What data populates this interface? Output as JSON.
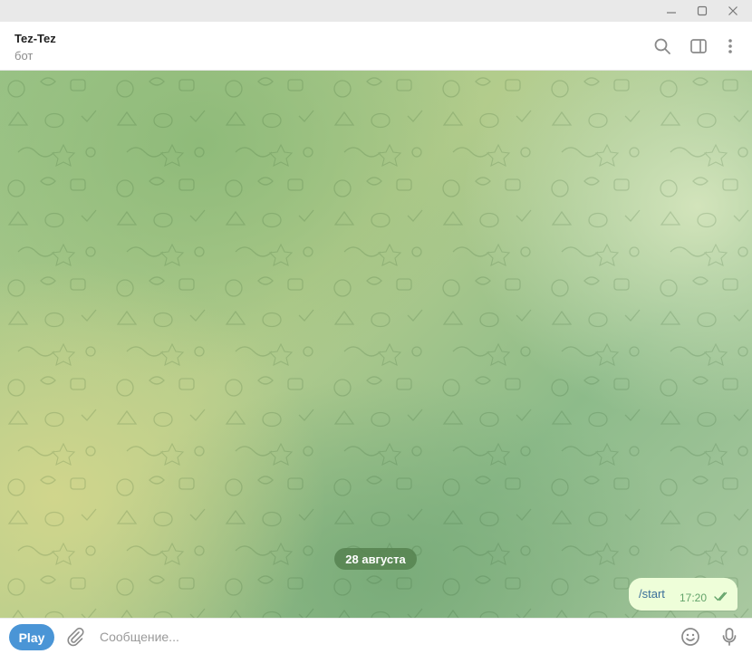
{
  "header": {
    "title": "Tez-Tez",
    "subtitle": "бот"
  },
  "chat": {
    "date_label": "28 августа",
    "messages": [
      {
        "text": "/start",
        "time": "17:20",
        "status": "read"
      }
    ]
  },
  "composer": {
    "bot_button_label": "Play",
    "input_value": "",
    "input_placeholder": "Сообщение..."
  },
  "icons": {
    "window": [
      "minimize-icon",
      "maximize-icon",
      "close-icon"
    ],
    "header": [
      "search-icon",
      "sidebar-toggle-icon",
      "more-vertical-icon"
    ],
    "composer": [
      "paperclip-icon",
      "emoji-icon",
      "microphone-icon"
    ]
  },
  "colors": {
    "accent": "#4a95d6",
    "outgoing_bubble": "#eefed9",
    "date_pill": "#568250"
  }
}
